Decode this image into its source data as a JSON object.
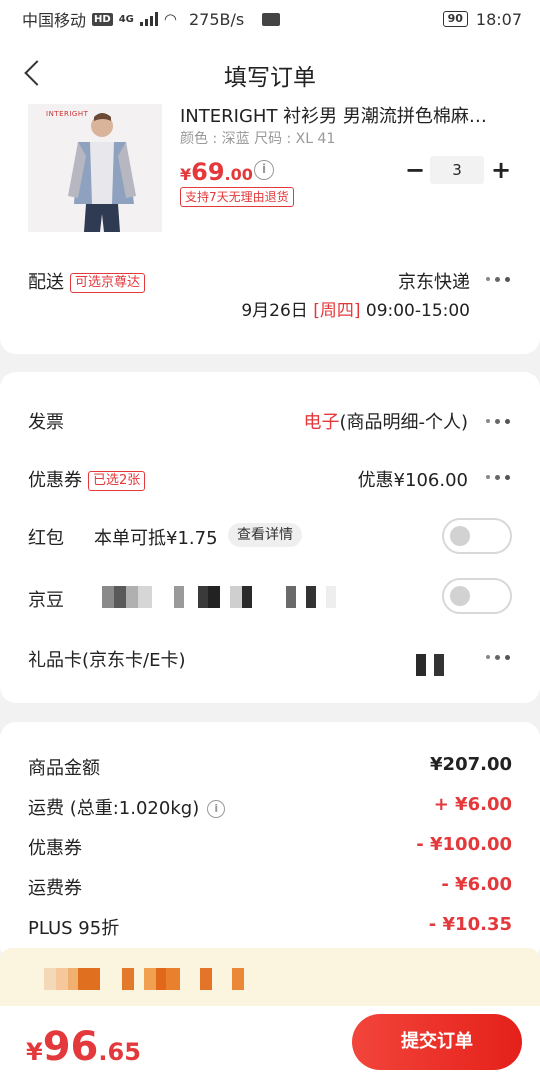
{
  "status_bar": {
    "carrier": "中国移动",
    "hd": "HD",
    "network": "4G",
    "speed": "275B/s",
    "battery": "90",
    "time": "18:07"
  },
  "nav": {
    "title": "填写订单",
    "back_icon": "chevron-left-icon"
  },
  "product": {
    "brand_logo_text": "INTERIGHT",
    "title": "INTERIGHT 衬衫男 男潮流拼色棉麻…",
    "spec": "颜色 : 深蓝   尺码 : XL 41",
    "price_symbol": "¥",
    "price_int": "69",
    "price_dec": ".00",
    "info_icon": "i",
    "return_tag": "支持7天无理由退货",
    "quantity": "3",
    "minus": "−",
    "plus": "+"
  },
  "delivery": {
    "label": "配送",
    "badge": "可选京尊达",
    "carrier": "京东快递",
    "date": "9月26日",
    "weekday": "[周四]",
    "time": "09:00-15:00"
  },
  "invoice": {
    "label": "发票",
    "type_red": "电子",
    "type_detail": "(商品明细-个人)"
  },
  "coupon": {
    "label": "优惠券",
    "badge": "已选2张",
    "value": "优惠¥106.00"
  },
  "red_packet": {
    "label": "红包",
    "text": "本单可抵¥1.75",
    "chip": "查看详情",
    "enabled": false
  },
  "jd_beans": {
    "label": "京豆",
    "enabled": false
  },
  "gift_card": {
    "label": "礼品卡(京东卡/E卡)"
  },
  "summary": {
    "items": [
      {
        "label": "商品金额",
        "value": "¥207.00",
        "color": "black"
      },
      {
        "label": "运费 (总重:1.020kg)",
        "value": "+ ¥6.00",
        "color": "red",
        "has_info": true,
        "info_icon": "i"
      },
      {
        "label": "优惠券",
        "value": "- ¥100.00",
        "color": "red"
      },
      {
        "label": "运费券",
        "value": "- ¥6.00",
        "color": "red"
      },
      {
        "label": "PLUS 95折",
        "value": "- ¥10.35",
        "color": "red"
      }
    ]
  },
  "total": {
    "symbol": "¥",
    "int": "96",
    "dec": ".65"
  },
  "submit_label": "提交订单",
  "colors": {
    "accent": "#e4393c",
    "notice_bg": "#fbf4df",
    "page_bg": "#f2f2f2"
  }
}
